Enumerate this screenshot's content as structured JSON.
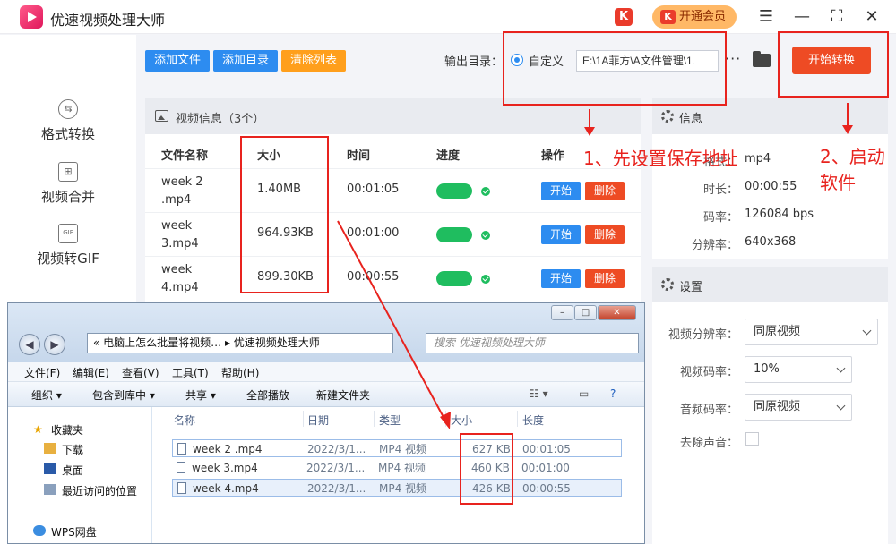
{
  "app": {
    "title": "优速视频处理大师",
    "vip_label": "开通会员",
    "vip_k": "K"
  },
  "window_controls": [
    "☰",
    "—",
    "⛶",
    "✕"
  ],
  "sidebar": {
    "items": [
      {
        "label": "格式转换",
        "icon": "⇆"
      },
      {
        "label": "视频合并",
        "icon": "⊞"
      },
      {
        "label": "视频转GIF",
        "icon": "GIF"
      }
    ]
  },
  "toolbar": {
    "add_file": "添加文件",
    "add_dir": "添加目录",
    "clear_list": "清除列表",
    "output_label": "输出目录：",
    "custom_label": "自定义",
    "output_path": "E:\\1A菲方\\A文件管理\\1.",
    "more": "···",
    "start_all": "开始转换"
  },
  "file_panel": {
    "header": "视频信息（3个）",
    "columns": {
      "name": "文件名称",
      "size": "大小",
      "time": "时间",
      "progress": "进度",
      "action": "操作"
    },
    "rows": [
      {
        "name": "week 2 .mp4",
        "size": "1.40MB",
        "time": "00:01:05",
        "progress": 1.0,
        "start": "开始",
        "delete": "删除"
      },
      {
        "name": "week 3.mp4",
        "size": "964.93KB",
        "time": "00:01:00",
        "progress": 1.0,
        "start": "开始",
        "delete": "删除"
      },
      {
        "name": "week 4.mp4",
        "size": "899.30KB",
        "time": "00:00:55",
        "progress": 1.0,
        "start": "开始",
        "delete": "删除"
      }
    ]
  },
  "info_panel": {
    "header": "信息",
    "format_label": "格式：",
    "format": "mp4",
    "duration_label": "时长：",
    "duration": "00:00:55",
    "bitrate_label": "码率：",
    "bitrate": "126084 bps",
    "resolution_label": "分辨率：",
    "resolution": "640x368"
  },
  "settings_panel": {
    "header": "设置",
    "video_res_label": "视频分辨率：",
    "video_res": "同原视频",
    "video_bitrate_label": "视频码率：",
    "video_bitrate": "10%",
    "audio_bitrate_label": "音频码率：",
    "audio_bitrate": "同原视频",
    "mute_label": "去除声音："
  },
  "annotations": {
    "step1": "1、先设置保存地址",
    "step2_line1": "2、启动",
    "step2_line2": "软件"
  },
  "explorer": {
    "address": "«  电脑上怎么批量将视频…  ▸  优速视频处理大师",
    "search_placeholder": "搜索 优速视频处理大师",
    "menu": [
      "文件(F)",
      "编辑(E)",
      "查看(V)",
      "工具(T)",
      "帮助(H)"
    ],
    "commands": [
      "组织 ▾",
      "包含到库中 ▾",
      "共享 ▾",
      "全部播放",
      "新建文件夹"
    ],
    "nav": [
      "收藏夹",
      "下载",
      "桌面",
      "最近访问的位置",
      "WPS网盘"
    ],
    "columns": {
      "name": "名称",
      "date": "日期",
      "type": "类型",
      "size": "大小",
      "length": "长度"
    },
    "files": [
      {
        "name": "week 2 .mp4",
        "date": "2022/3/1...",
        "type": "MP4 视频",
        "size": "627 KB",
        "length": "00:01:05"
      },
      {
        "name": "week 3.mp4",
        "date": "2022/3/1...",
        "type": "MP4 视频",
        "size": "460 KB",
        "length": "00:01:00"
      },
      {
        "name": "week 4.mp4",
        "date": "2022/3/1...",
        "type": "MP4 视频",
        "size": "426 KB",
        "length": "00:00:55"
      }
    ]
  },
  "colors": {
    "accent": "#2d8cf0",
    "start": "#ee4b24",
    "annotation": "#e8231e",
    "progress": "#1fbd5f"
  }
}
